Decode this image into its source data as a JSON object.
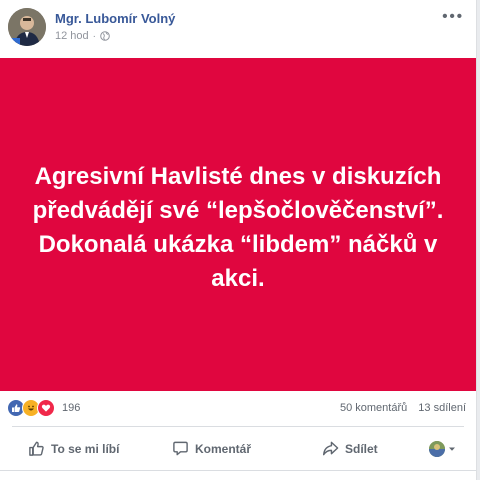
{
  "post": {
    "author": "Mgr. Lubomír Volný",
    "time": "12 hod",
    "separator": "·",
    "more": "•••",
    "banner_text": "Agresivní Havlisté dnes v diskuzích předvádějí své “lepšočlověčenství”. Dokonalá ukázka “libdem” náčků v akci.",
    "banner_color": "#e0063f",
    "reaction_count": "196",
    "comments": "50 komentářů",
    "shares": "13 sdílení",
    "actions": {
      "like": "To se mi líbí",
      "comment": "Komentář",
      "share": "Sdílet"
    },
    "icons": [
      "globe-icon",
      "like-icon",
      "comment-icon",
      "share-icon",
      "haha-reaction-icon",
      "love-reaction-icon"
    ]
  }
}
